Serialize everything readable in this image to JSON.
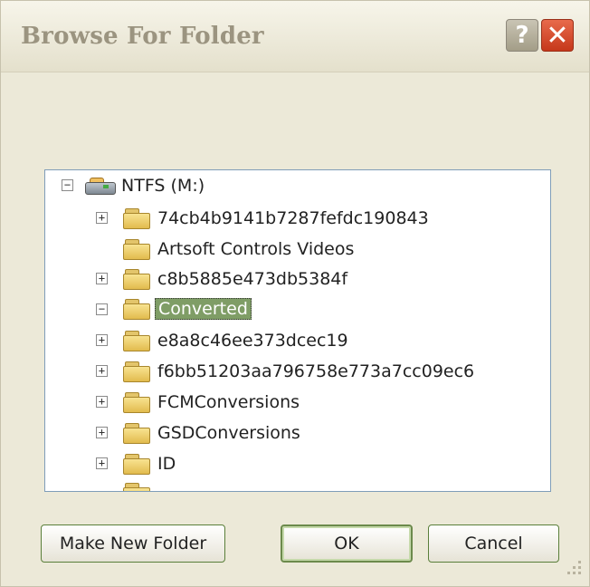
{
  "window": {
    "title": "Browse For Folder",
    "help_button": "?",
    "close_button": "✕"
  },
  "tree": {
    "root": {
      "label": "NTFS (M:)",
      "expander": "⊟"
    },
    "items": [
      {
        "label": "74cb4b9141b7287fefdc190843",
        "expander": "+"
      },
      {
        "label": "Artsoft Controls Videos",
        "expander": ""
      },
      {
        "label": "c8b5885e473db5384f",
        "expander": "+"
      },
      {
        "label": "Converted",
        "expander": "−",
        "selected": true
      },
      {
        "label": "e8a8c46ee373dcec19",
        "expander": "+"
      },
      {
        "label": "f6bb51203aa796758e773a7cc09ec6",
        "expander": "+"
      },
      {
        "label": "FCMConversions",
        "expander": "+"
      },
      {
        "label": "GSDConversions",
        "expander": "+"
      },
      {
        "label": "ID",
        "expander": "+"
      }
    ],
    "scroll_up": "▲",
    "scroll_down": "▼"
  },
  "buttons": {
    "make_new_folder": "Make New Folder",
    "ok": "OK",
    "cancel": "Cancel"
  },
  "colors": {
    "selection": "#7f9d66",
    "dialog_background": "#ece9d8"
  }
}
